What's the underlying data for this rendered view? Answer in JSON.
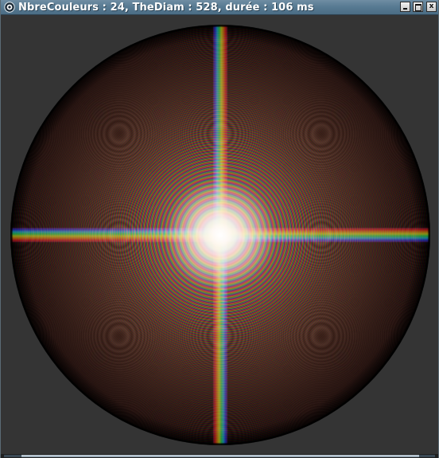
{
  "window": {
    "title": "NbreCouleurs : 24, TheDiam : 528, durée : 106 ms",
    "controls": {
      "minimize": "minimize",
      "maximize": "maximize",
      "close": "x"
    }
  },
  "rendering": {
    "color_count": 24,
    "diameter": 528,
    "duration_ms": 106
  },
  "colors": {
    "titlebar": "#587b93",
    "background": "#343434",
    "center_glow": "#ffffff"
  },
  "icons": {
    "app": "app-icon",
    "minimize": "minimize-icon",
    "maximize": "maximize-icon",
    "close": "close-icon"
  }
}
